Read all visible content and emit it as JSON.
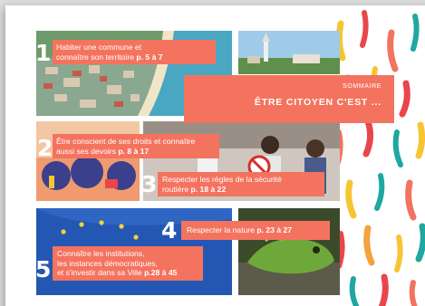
{
  "header": {
    "subtitle": "SOMMAIRE",
    "title": "ÊTRE CITOYEN C'EST ..."
  },
  "sections": [
    {
      "number": "1",
      "line1": "Habiter une commune et",
      "line2": "connaître son territoire",
      "pages": "p. 5 à 7"
    },
    {
      "number": "2",
      "line1": "Être conscient de ses droits et connaître",
      "line2": "aussi ses devoirs",
      "pages": "p. 8 à 17"
    },
    {
      "number": "3",
      "line1": "Respecter les règles de la sécurité",
      "line2": "routière",
      "pages": "p. 18 à 22"
    },
    {
      "number": "4",
      "line1": "Respecter la nature",
      "pages": "p. 23 à 27"
    },
    {
      "number": "5",
      "line1": "Connaître les institutions,",
      "line2": "les instances démocratiques,",
      "line3": "et s'investir dans sa Ville",
      "pages": "p.28 à 45"
    }
  ],
  "colors": {
    "accent": "#f4735f",
    "strokes": [
      "#f4735f",
      "#f7c531",
      "#1fa7a0",
      "#e8464b",
      "#f3a33c"
    ]
  }
}
